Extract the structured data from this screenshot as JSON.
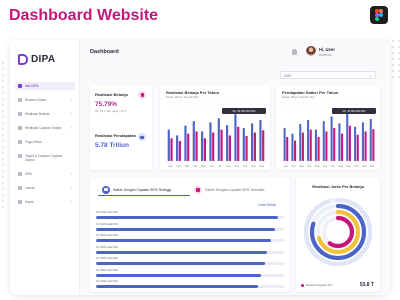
{
  "shot_title": "Dashboard Website",
  "app": {
    "logo_text": "DIPA"
  },
  "sidebar": {
    "items": [
      {
        "label": "Info DIPA",
        "active": true,
        "chevron": ""
      },
      {
        "label": "Rincian Output",
        "active": false,
        "chevron": "›"
      },
      {
        "label": "Realisasi Belanja",
        "active": false,
        "chevron": "›"
      },
      {
        "label": "Realisasi Capaian Output",
        "active": false,
        "chevron": "›"
      },
      {
        "label": "Pagu Minus",
        "active": false,
        "chevron": ""
      },
      {
        "label": "Target & Capaian Capaian Output",
        "active": false,
        "chevron": ""
      },
      {
        "label": "IKPA",
        "active": false,
        "chevron": "›"
      },
      {
        "label": "Laman",
        "active": false,
        "chevron": "›"
      },
      {
        "label": "Hapal",
        "active": false,
        "chevron": "›"
      }
    ]
  },
  "header": {
    "title": "Dashboard",
    "user_name": "Hi, User",
    "user_role": "Bapenas"
  },
  "filter": {
    "year": "2024",
    "chevron": "⌄"
  },
  "kpis": {
    "realisasi_belanja": {
      "label": "Realisasi Belanja",
      "value": "75.79%",
      "sub": "Rp. 10 T dari pagu : 10 T"
    },
    "realisasi_pendapatan": {
      "label": "Realisasi Pendapatan",
      "value": "5.78 Triliun"
    }
  },
  "charts": {
    "bar1": {
      "title": "Realisasi Belanja Per Tahun",
      "subtitle": "Dalam Miliyar Rupiah (Rp)"
    },
    "bar2": {
      "title": "Pendapatan Satker Per Tahun",
      "subtitle": "Dalam Miliyar Rupiah (Rp)"
    }
  },
  "tabs": [
    {
      "label": "Satker Dengan Capaian IKPA Tertinggi",
      "active": true
    },
    {
      "label": "Satker Dengan Capaian IKPA Terendah",
      "active": false
    }
  ],
  "see_all": "Lihat Detail",
  "ranking_rows": [
    {
      "label": "KO SDM Hasbi Bel",
      "fill": 0.97
    },
    {
      "label": "KO SDM Hasbi Bel",
      "fill": 0.95
    },
    {
      "label": "KO SDM Hasbi Bel",
      "fill": 0.93
    },
    {
      "label": "KO SDM Hasbi Bel",
      "fill": 0.91
    },
    {
      "label": "KO SDM Hasbi Bel",
      "fill": 0.9
    },
    {
      "label": "KO SDM Hasbi Bel",
      "fill": 0.88
    },
    {
      "label": "KO SDM Hasbi Bel",
      "fill": 0.86
    }
  ],
  "radial": {
    "title": "Realisasi Jenis Per Belanja",
    "legend_label": "Belanja Pegawai (51)",
    "value": "53.8 T",
    "colors": [
      "#e0e4f7",
      "#4c64c6",
      "#f3c23b",
      "#c4167c"
    ]
  },
  "colors": {
    "accent": "#4c64c6",
    "brand": "#c4167c",
    "purple": "#7a3cc9"
  },
  "chart_data": [
    {
      "type": "bar",
      "title": "Realisasi Belanja Per Tahun",
      "subtitle": "Dalam Miliyar Rupiah (Rp)",
      "categories": [
        "Jan",
        "Feb",
        "Mar",
        "Apr",
        "May",
        "Jun",
        "Jul",
        "Aug",
        "Sep",
        "Oct",
        "Nov",
        "Dec"
      ],
      "series": [
        {
          "values": [
            55,
            45,
            62,
            70,
            52,
            68,
            75,
            63,
            82,
            58,
            66,
            72
          ],
          "color": "#4c64c6"
        },
        {
          "values": [
            40,
            35,
            48,
            52,
            40,
            50,
            55,
            45,
            60,
            44,
            50,
            54
          ],
          "color": "#c4167c"
        }
      ],
      "ylim": [
        0,
        100
      ],
      "tick_labels": [
        "Jan",
        "Feb",
        "Mar",
        "Apr",
        "May",
        "Jun",
        "Jul",
        "Aug",
        "Sep",
        "Oct",
        "Nov",
        "Dec"
      ],
      "tooltip": "Rp. 40.000.000.000"
    },
    {
      "type": "bar",
      "title": "Pendapatan Satker Per Tahun",
      "subtitle": "Dalam Miliyar Rupiah (Rp)",
      "categories": [
        "Jan",
        "Feb",
        "Mar",
        "Apr",
        "May",
        "Jun",
        "Jul",
        "Aug",
        "Sep",
        "Oct",
        "Nov",
        "Dec"
      ],
      "series": [
        {
          "values": [
            58,
            48,
            65,
            72,
            55,
            70,
            78,
            66,
            85,
            60,
            68,
            74
          ],
          "color": "#4c64c6"
        },
        {
          "values": [
            42,
            36,
            50,
            55,
            42,
            52,
            58,
            48,
            62,
            46,
            52,
            56
          ],
          "color": "#c4167c"
        }
      ],
      "ylim": [
        0,
        100
      ],
      "tick_labels": [
        "Jan",
        "Feb",
        "Mar",
        "Apr",
        "May",
        "Jun",
        "Jul",
        "Aug",
        "Sep",
        "Oct",
        "Nov",
        "Dec"
      ],
      "tooltip": "Rp. 40.000.000.000"
    },
    {
      "type": "pie",
      "title": "Realisasi Jenis Per Belanja",
      "note": "concentric radial rings",
      "values": [
        0.95,
        0.8,
        0.7,
        0.6
      ],
      "colors": [
        "#e0e4f7",
        "#4c64c6",
        "#f3c23b",
        "#c4167c"
      ]
    }
  ]
}
